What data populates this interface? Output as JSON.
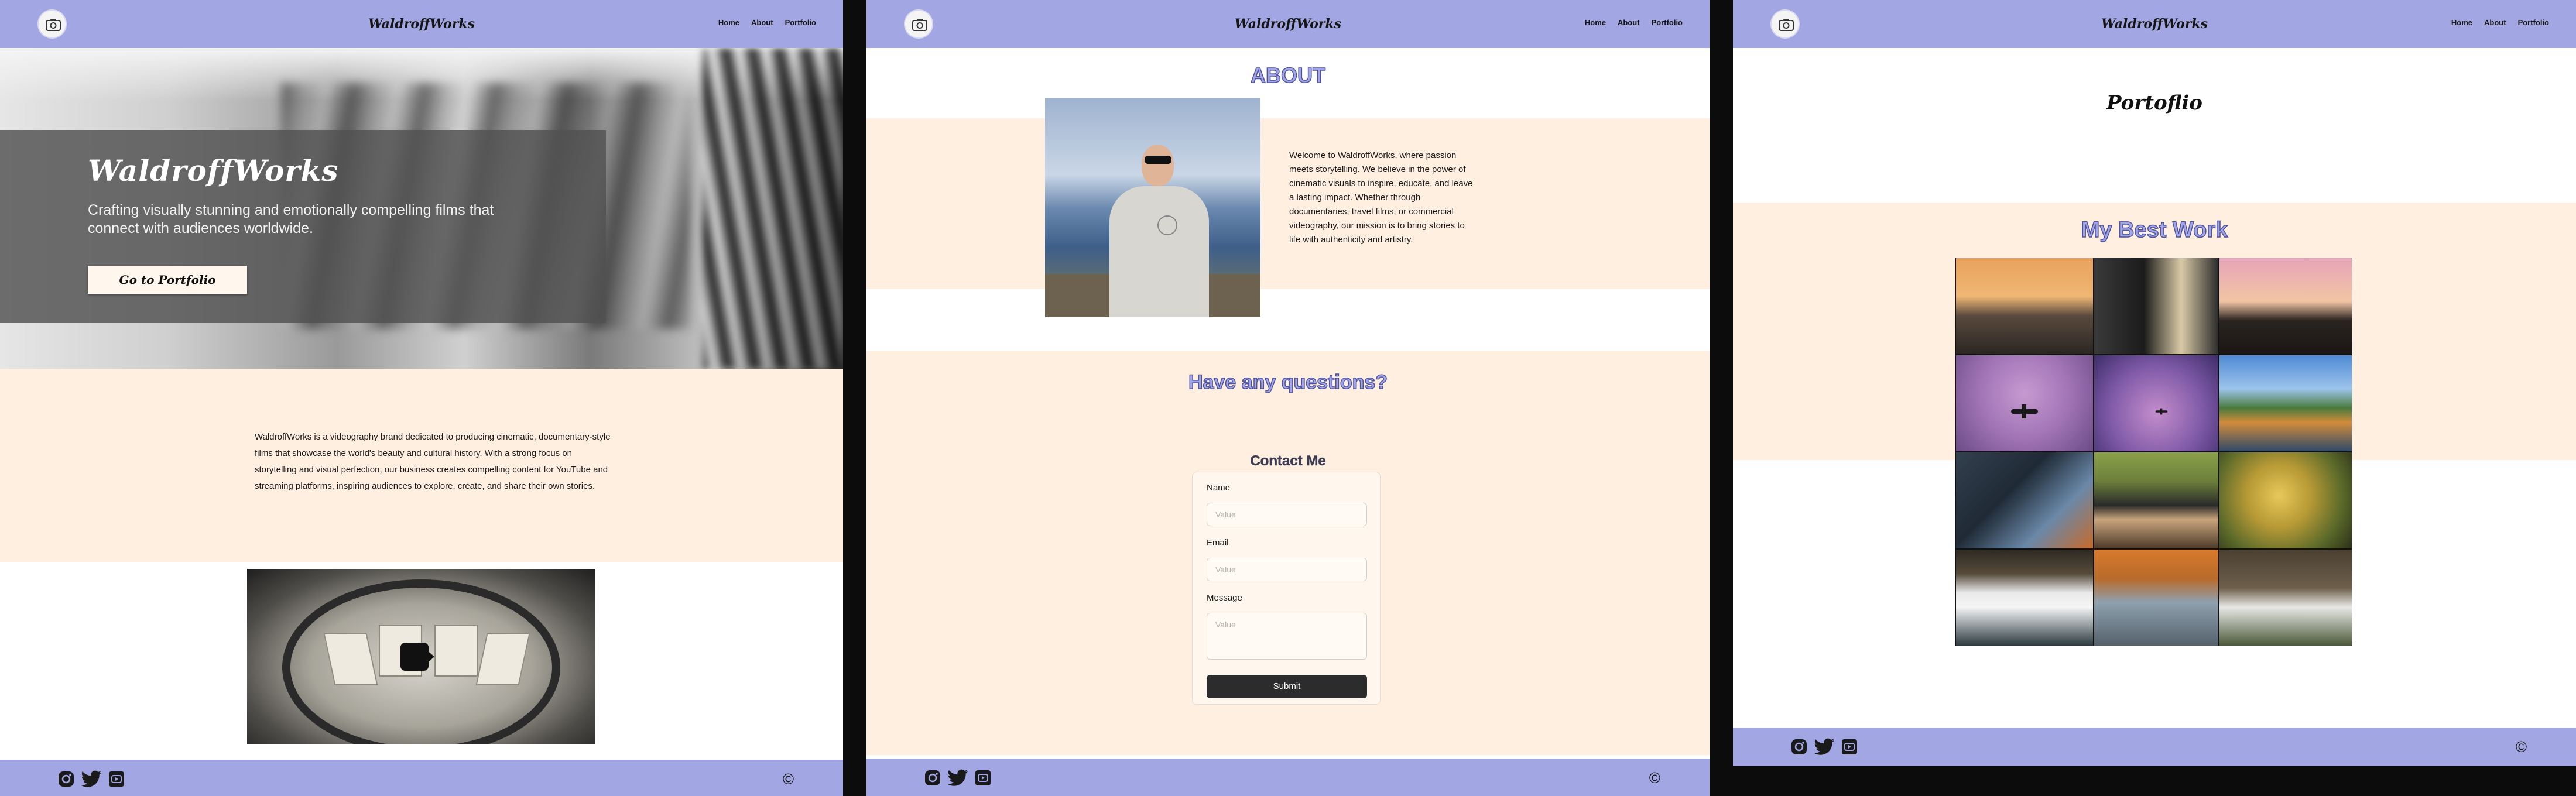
{
  "brand": "WaldroffWorks",
  "nav": {
    "home": "Home",
    "about": "About",
    "portfolio": "Portfolio"
  },
  "footer": {
    "copyright": "©"
  },
  "colors": {
    "nav": "#a2a7e3",
    "cream": "#feefe1",
    "outline": "#4d51a0"
  },
  "home": {
    "hero_title": "WaldroffWorks",
    "hero_subtitle": "Crafting visually stunning and emotionally compelling films that connect with audiences worldwide.",
    "cta": "Go to Portfolio",
    "intro": "WaldroffWorks is a videography brand dedicated to producing cinematic, documentary-style films that showcase the world's beauty and cultural history. With a strong focus on storytelling and visual perfection, our business creates compelling content for YouTube and streaming platforms, inspiring audiences to explore, create, and share their own stories."
  },
  "about": {
    "title": "ABOUT",
    "text": "Welcome to WaldroffWorks, where passion meets storytelling. We believe in the power of cinematic visuals to inspire, educate, and leave a lasting impact. Whether through documentaries, travel films, or commercial videography, our mission is to bring stories to life with authenticity and artistry.",
    "questions": "Have any questions?",
    "contact_title": "Contact Me",
    "form": {
      "name_label": "Name",
      "name_placeholder": "Value",
      "email_label": "Email",
      "email_placeholder": "Value",
      "message_label": "Message",
      "message_placeholder": "Value",
      "submit": "Submit"
    }
  },
  "portfolio": {
    "title": "Portoflio",
    "best_title": "My Best Work"
  },
  "icons": [
    "camera-icon",
    "instagram-icon",
    "twitter-icon",
    "youtube-icon",
    "play-icon"
  ]
}
